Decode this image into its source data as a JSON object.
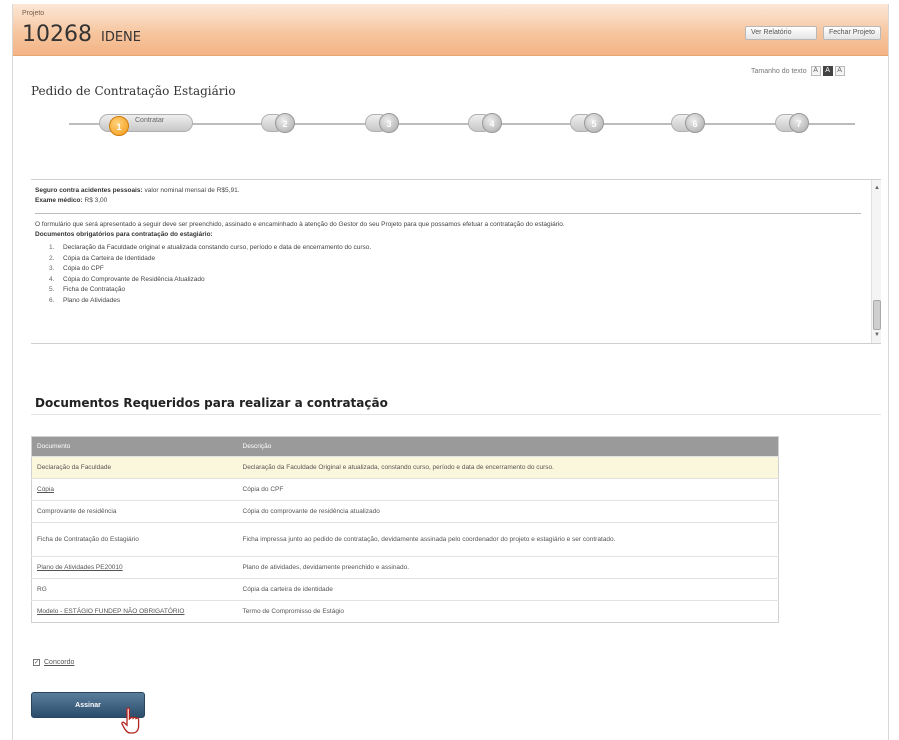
{
  "header": {
    "project_label": "Projeto",
    "project_number": "10268",
    "project_name": "IDENE",
    "view_button": "Ver Relatório",
    "close_button": "Fechar Projeto"
  },
  "text_size": {
    "label": "Tamanho do texto",
    "options": [
      "A",
      "A",
      "A"
    ],
    "active_index": 1
  },
  "page_title": "Pedido de Contratação Estagiário",
  "steps": {
    "active_number": "1",
    "active_label": "Contratar",
    "others": [
      "2",
      "3",
      "4",
      "5",
      "6",
      "7"
    ]
  },
  "info": {
    "insurance_label": "Seguro contra acidentes pessoais:",
    "insurance_text": "valor nominal mensal de R$5,91.",
    "exam_label": "Exame médico:",
    "exam_text": "R$ 3,00",
    "instructions": "O formulário que será apresentado a seguir deve ser preenchido, assinado e encaminhado à atenção do Gestor do seu Projeto para que possamos efetuar a contratação do estagiário.",
    "docs_title": "Documentos obrigatórios para contratação do estagiário:",
    "docs": [
      {
        "n": "1.",
        "text": "Declaração da Faculdade original e atualizada constando curso, período e data de encerramento do curso."
      },
      {
        "n": "2.",
        "text": "Cópia da Carteira de Identidade"
      },
      {
        "n": "3.",
        "text": "Cópia do CPF"
      },
      {
        "n": "4.",
        "text": "Cópia do Comprovante de Residência Atualizado"
      },
      {
        "n": "5.",
        "text": "Ficha de Contratação"
      },
      {
        "n": "6.",
        "text": "Plano de Atividades"
      }
    ]
  },
  "required": {
    "title": "Documentos Requeridos para realizar a contratação",
    "columns": [
      "Documento",
      "Descrição"
    ],
    "rows": [
      {
        "doc": "Declaração da Faculdade",
        "desc": "Declaração da Faculdade Original e atualizada, constando curso, período e data de encerramento do curso.",
        "link": false,
        "highlight": true
      },
      {
        "doc": "Cópia",
        "desc": "Cópia do CPF",
        "link": true,
        "highlight": false
      },
      {
        "doc": "Comprovante de residência",
        "desc": "Cópia do comprovante de residência atualizado",
        "link": false,
        "highlight": false
      },
      {
        "doc": "Ficha de Contratação do Estagiário",
        "desc": "Ficha impressa junto ao pedido de contratação, devidamente assinada pelo coordenador do projeto e estagiário e ser contratado.",
        "link": false,
        "highlight": false
      },
      {
        "doc": "Plano de Atividades PE20010",
        "desc": "Plano de atividades, devidamente preenchido e assinado.",
        "link": true,
        "highlight": false
      },
      {
        "doc": "RG",
        "desc": "Cópia da carteira de identidade",
        "link": false,
        "highlight": false
      },
      {
        "doc": "Modelo - ESTÁGIO FUNDEP NÃO OBRIGATÓRIO",
        "desc": "Termo de Compromisso de Estágio",
        "link": true,
        "highlight": false
      }
    ]
  },
  "agree_label": "Concordo",
  "assign_button": "Assinar"
}
